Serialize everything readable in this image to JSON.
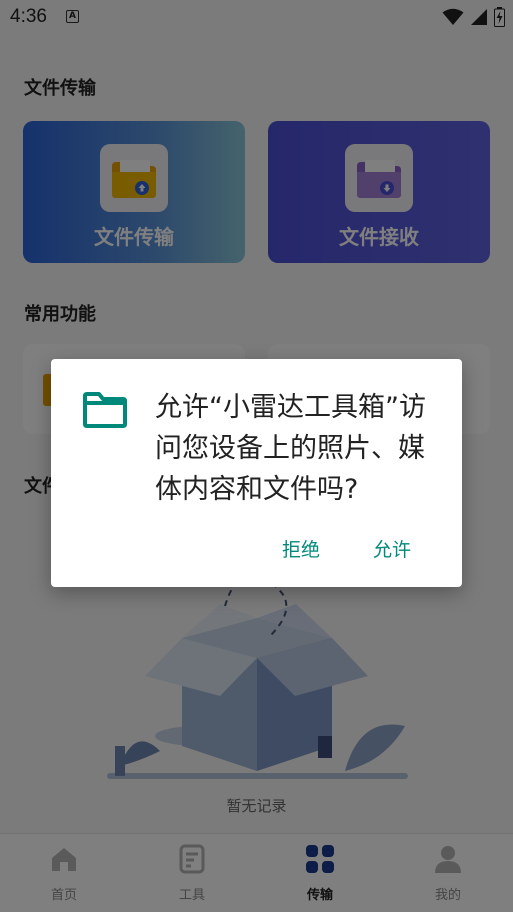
{
  "status_bar": {
    "time": "4:36",
    "notification_icon": "A"
  },
  "sections": {
    "transfer_title": "文件传输",
    "functions_title": "常用功能",
    "files_title": "文件"
  },
  "cards": {
    "send_label": "文件传输",
    "receive_label": "文件接收"
  },
  "empty_state": {
    "text": "暂无记录"
  },
  "tabs": [
    {
      "label": "首页",
      "icon": "home-icon"
    },
    {
      "label": "工具",
      "icon": "tools-icon"
    },
    {
      "label": "传输",
      "icon": "grid-icon",
      "active": true
    },
    {
      "label": "我的",
      "icon": "user-icon"
    }
  ],
  "dialog": {
    "icon": "folder-icon",
    "message": "允许“小雷达工具箱”访问您设备上的照片、媒体内容和文件吗?",
    "deny_label": "拒绝",
    "allow_label": "允许"
  },
  "colors": {
    "accent": "#00897b",
    "tab_active": "#1a3a8f"
  }
}
